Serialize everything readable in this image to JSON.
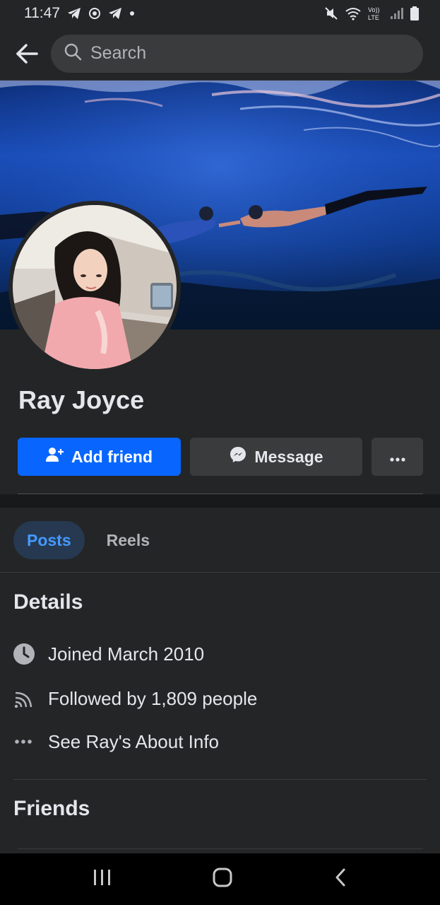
{
  "status_bar": {
    "time": "11:47",
    "left_icons": [
      "telegram-icon",
      "camera-icon",
      "telegram-icon",
      "dot-icon"
    ],
    "right_icons": [
      "mute-icon",
      "wifi-icon",
      "volte-icon",
      "signal-icon",
      "battery-icon"
    ],
    "volte_label": "Vo))\nLTE"
  },
  "header": {
    "search_placeholder": "Search"
  },
  "profile": {
    "name": "Ray Joyce"
  },
  "actions": {
    "add_friend_label": "Add friend",
    "message_label": "Message"
  },
  "tabs": [
    {
      "label": "Posts",
      "active": true
    },
    {
      "label": "Reels",
      "active": false
    }
  ],
  "details": {
    "title": "Details",
    "items": [
      {
        "icon": "clock-icon",
        "text": "Joined March 2010"
      },
      {
        "icon": "rss-icon",
        "text": "Followed by 1,809 people"
      },
      {
        "icon": "more-dots-icon",
        "text": "See Ray's About Info"
      }
    ]
  },
  "friends": {
    "title": "Friends"
  },
  "colors": {
    "background": "#242526",
    "primary": "#0866ff",
    "tab_active_bg": "#263951",
    "tab_active_text": "#4599ff"
  }
}
